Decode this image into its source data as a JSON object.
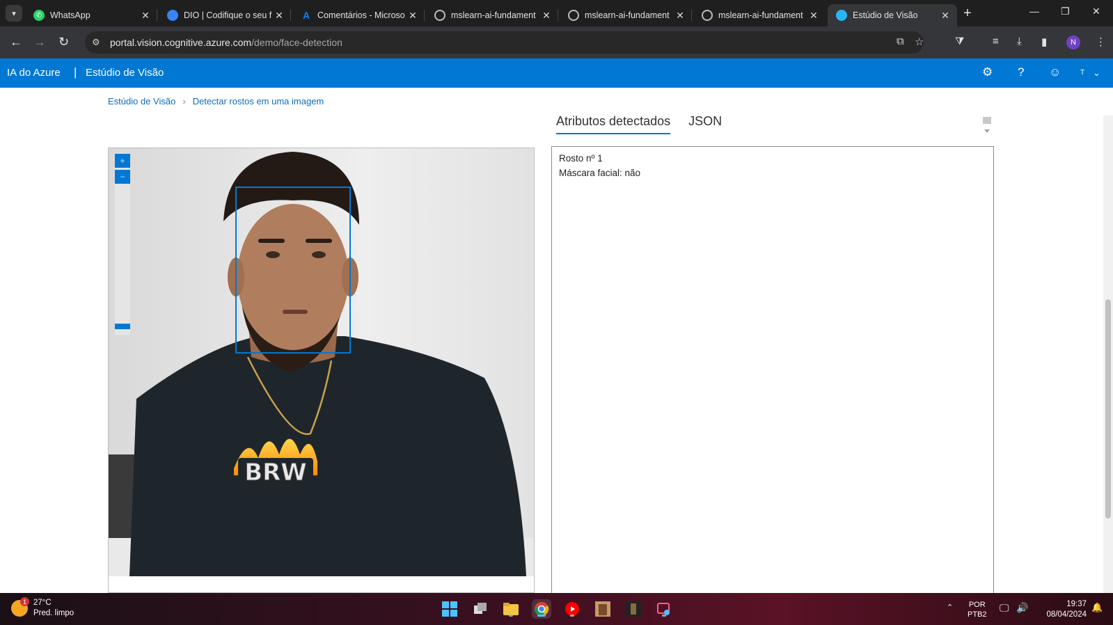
{
  "browser": {
    "tabs": [
      {
        "title": "WhatsApp",
        "icon": "whatsapp-icon",
        "color": "#25d366"
      },
      {
        "title": "DIO | Codifique o seu f",
        "icon": "dio-icon",
        "color": "#3b82f6"
      },
      {
        "title": "Comentários - Microso",
        "icon": "azure-icon",
        "color": "#0a84ff"
      },
      {
        "title": "mslearn-ai-fundament",
        "icon": "globe-icon",
        "color": "#bdbdbd"
      },
      {
        "title": "mslearn-ai-fundament",
        "icon": "globe-icon",
        "color": "#bdbdbd"
      },
      {
        "title": "mslearn-ai-fundament",
        "icon": "globe-icon",
        "color": "#bdbdbd"
      },
      {
        "title": "Estúdio de Visão",
        "icon": "vision-studio-icon",
        "color": "#29b6f6",
        "active": true
      }
    ],
    "url_host": "portal.vision.cognitive.azure.com",
    "url_path": "/demo/face-detection",
    "profile_initial": "N"
  },
  "header": {
    "brand": "IA do Azure",
    "separator": "|",
    "product": "Estúdio de Visão",
    "user_initial": "T",
    "accent": "#0078d4"
  },
  "breadcrumb": {
    "root": "Estúdio de Visão",
    "current": "Detectar rostos em uma imagem"
  },
  "viewer": {
    "zoom_in": "+",
    "zoom_out": "−",
    "shirt_print": "BRW"
  },
  "results_tabs": {
    "attributes": "Atributos detectados",
    "json": "JSON"
  },
  "results": {
    "face_label": "Rosto nº 1",
    "mask_label": "Máscara facial: não"
  },
  "taskbar": {
    "temperature": "27°C",
    "weather": "Pred. limpo",
    "weather_badge": "1",
    "language": "POR",
    "keyboard": "PTB2",
    "time": "19:37",
    "date": "08/04/2024"
  }
}
